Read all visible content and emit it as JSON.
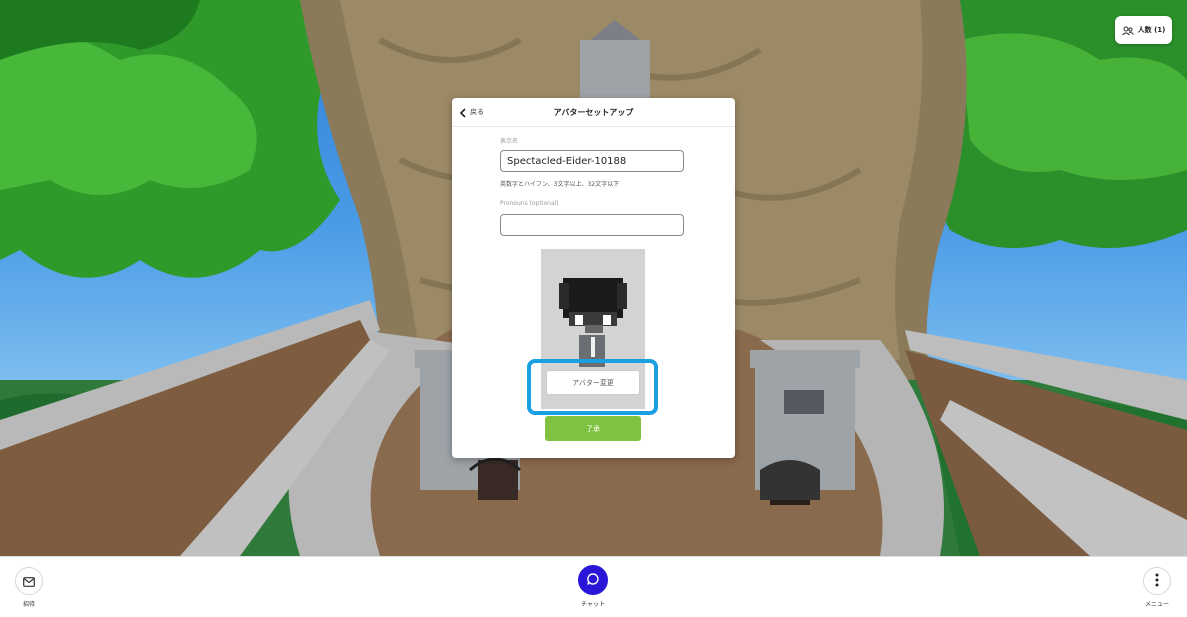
{
  "top_right": {
    "people_label": "人数 (1)"
  },
  "modal": {
    "back_label": "戻る",
    "title": "アバターセットアップ",
    "display_name_label": "表示名",
    "display_name_value": "Spectacled-Eider-10188",
    "display_name_hint": "英数字とハイフン、3文字以上、32文字以下",
    "pronouns_label": "Pronouns (optional)",
    "pronouns_value": "",
    "avatar_change_label": "アバター変更",
    "ok_label": "了承"
  },
  "bottom_bar": {
    "invite_label": "招待",
    "chat_label": "チャット",
    "menu_label": "メニュー"
  },
  "colors": {
    "accent_highlight": "#1aa0e0",
    "ok_button": "#7fc241",
    "chat_button": "#2a16d6"
  },
  "icons": {
    "people": "people-icon",
    "back": "chevron-left-icon",
    "invite": "mail-icon",
    "chat": "chat-bubble-icon",
    "menu": "vertical-dots-icon"
  }
}
